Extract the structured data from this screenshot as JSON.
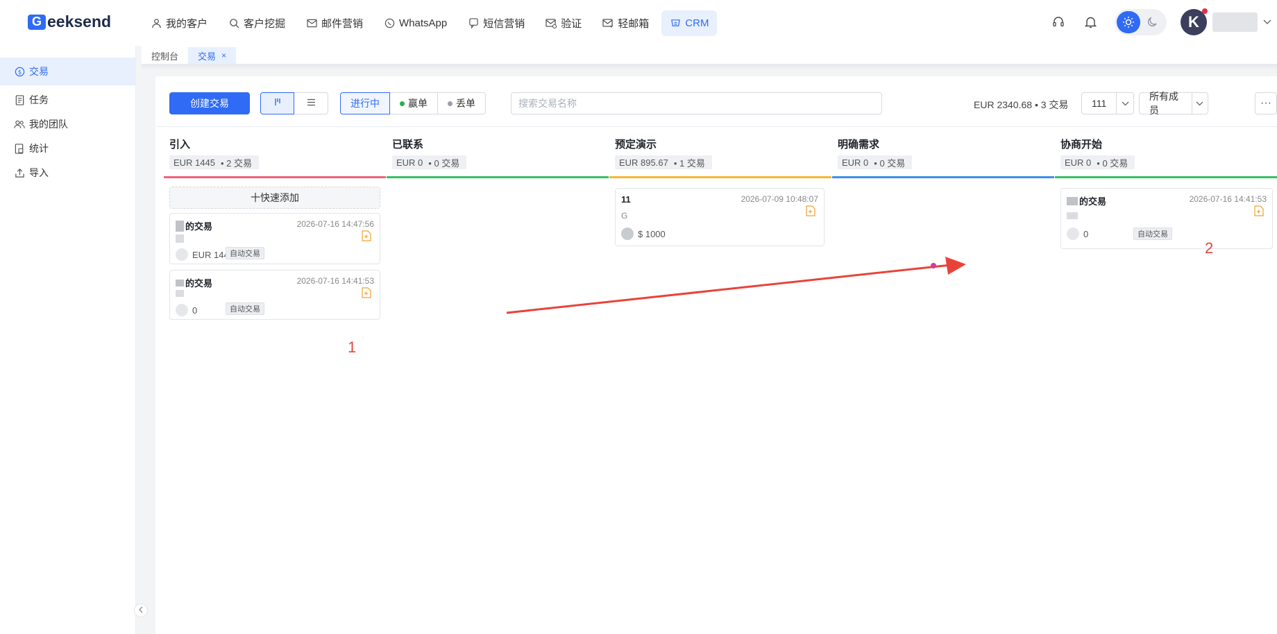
{
  "brand": {
    "logo_letter": "G",
    "logo_text": "eeksend"
  },
  "topnav": {
    "items": [
      {
        "label": "我的客户",
        "icon": "user-icon"
      },
      {
        "label": "客户挖掘",
        "icon": "search-icon"
      },
      {
        "label": "邮件营销",
        "icon": "mail-icon"
      },
      {
        "label": "WhatsApp",
        "icon": "whatsapp-icon"
      },
      {
        "label": "短信营销",
        "icon": "sms-icon"
      },
      {
        "label": "验证",
        "icon": "verify-mail-icon"
      },
      {
        "label": "轻邮箱",
        "icon": "light-mail-icon"
      },
      {
        "label": "CRM",
        "icon": "crm-icon",
        "active": true
      }
    ],
    "avatar_letter": "K"
  },
  "page_tabs": [
    {
      "label": "控制台"
    },
    {
      "label": "交易",
      "active": true,
      "close": "×"
    }
  ],
  "sidebar": {
    "items": [
      {
        "label": "交易",
        "icon": "dollar-icon",
        "active": true
      },
      {
        "label": "任务",
        "icon": "document-icon"
      },
      {
        "label": "我的团队",
        "icon": "team-icon"
      },
      {
        "label": "统计",
        "icon": "stats-icon"
      },
      {
        "label": "导入",
        "icon": "upload-icon"
      }
    ]
  },
  "toolbar": {
    "create_label": "创建交易",
    "status_filters": [
      {
        "label": "进行中",
        "active": true
      },
      {
        "label": "赢单",
        "dot_color": "#22b14c"
      },
      {
        "label": "丢单",
        "dot_color": "#9a9ea6"
      }
    ],
    "search_placeholder": "搜索交易名称",
    "summary": "EUR 2340.68 • 3 交易",
    "pipeline_select": "111",
    "member_select": "所有成员",
    "more": "···"
  },
  "columns": [
    {
      "title": "引入",
      "amount": "EUR 1445",
      "count": "• 2 交易",
      "color": "#f0627a",
      "quick_add": "十快速添加",
      "cards": [
        {
          "name": "的交易",
          "time": "2026-07-16 14:47:56",
          "amount": "EUR 1445",
          "tag": "自动交易"
        },
        {
          "name": "的交易",
          "time": "2026-07-16 14:41:53",
          "amount": "0",
          "tag": "自动交易"
        }
      ]
    },
    {
      "title": "已联系",
      "amount": "EUR 0",
      "count": "• 0 交易",
      "color": "#34c065",
      "cards": []
    },
    {
      "title": "预定演示",
      "amount": "EUR 895.67",
      "count": "• 1 交易",
      "color": "#f5b731",
      "cards": [
        {
          "name": "11",
          "time": "2026-07-09 10:48:07",
          "company": "G",
          "amount": "$ 1000"
        }
      ]
    },
    {
      "title": "明确需求",
      "amount": "EUR 0",
      "count": "• 0 交易",
      "color": "#3d8ef0",
      "cards": []
    },
    {
      "title": "协商开始",
      "amount": "EUR 0",
      "count": "• 0 交易",
      "color": "#34c065",
      "cards": [
        {
          "name": "的交易",
          "time": "2026-07-16 14:41:53",
          "amount": "0",
          "tag": "自动交易"
        }
      ]
    }
  ],
  "annotations": {
    "label_1": "1",
    "label_2": "2",
    "arrow_color": "#e8433b"
  }
}
